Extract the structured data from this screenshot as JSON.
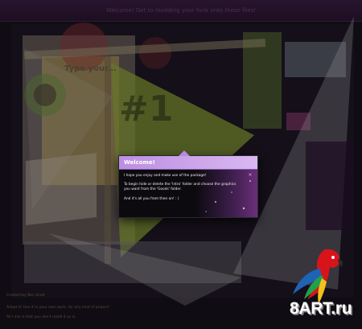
{
  "header": {
    "message": "Welcome! Get to modding your funk onto these files!"
  },
  "background": {
    "screen_title": "Type your..."
  },
  "popup": {
    "title": "Welcome!",
    "line1": "I hope you enjoy and make use of the package!",
    "line2": "To begin hide or delete the 'Intro' folder and choose the graphics",
    "line3": "you want from the 'Goods' folder.",
    "line4": "And it's all you from then on! : )",
    "close_icon": "close-icon"
  },
  "footer": {
    "line1": "Created by Ben Scott",
    "line2": "Adapt it! Use it in your own work, for any kind of project!",
    "line3": "All I ask is that you don't resell it as is."
  },
  "watermark": {
    "text": "8ART.ru"
  },
  "colors": {
    "popup_header": "#c9a3ea",
    "background": "#141018",
    "flag": "#a8c83a",
    "parrot_red": "#d8141a",
    "parrot_blue": "#1f63b6"
  }
}
